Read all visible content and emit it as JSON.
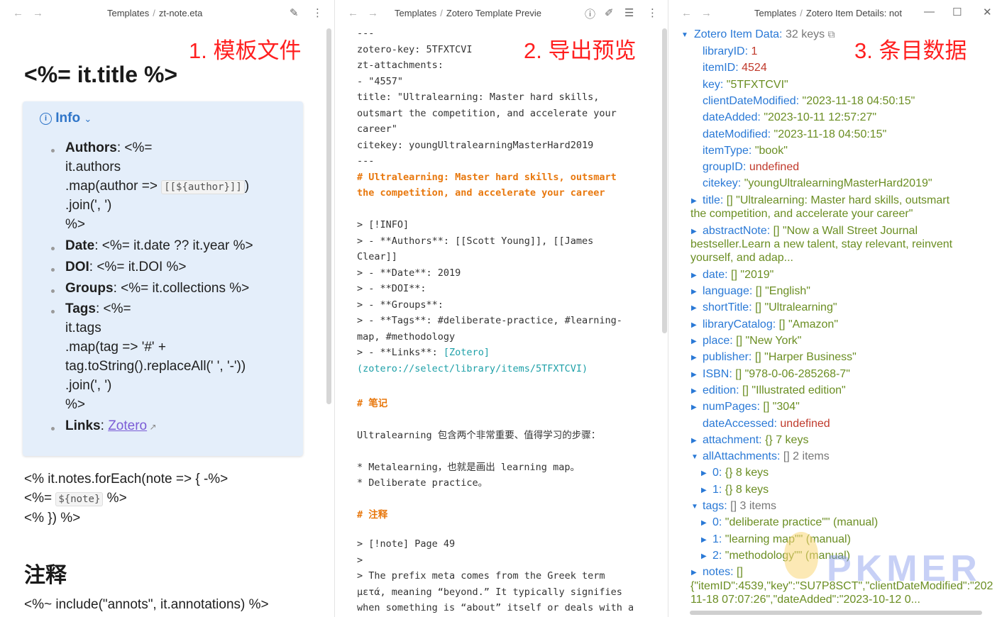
{
  "nav": {
    "back": "←",
    "forward": "→"
  },
  "pane1": {
    "breadcrumb": [
      "Templates",
      "zt-note.eta"
    ],
    "watermark": "1. 模板文件",
    "heading": "<%= it.title %>",
    "callout_title": "Info",
    "callout_lines": [
      {
        "label": "Authors",
        "text": ": <%="
      },
      {
        "text": "it.authors"
      },
      {
        "text": ".map(author =>",
        "code": "[[${author}]]",
        "tail": ")"
      },
      {
        "text": ".join(', ')"
      },
      {
        "text": "%>"
      },
      {
        "label": "Date",
        "text": ": <%= it.date ?? it.year %>"
      },
      {
        "label": "DOI",
        "text": ": <%= it.DOI %>"
      },
      {
        "label": "Groups",
        "text": ": <%= it.collections %>"
      },
      {
        "label": "Tags",
        "text": ": <%="
      },
      {
        "text": "it.tags"
      },
      {
        "text": ".map(tag => '#' +"
      },
      {
        "text": "tag.toString().replaceAll(' ', '-'))"
      },
      {
        "text": ".join(', ')"
      },
      {
        "text": "%>"
      },
      {
        "label": "Links",
        "text": ": ",
        "link": "Zotero"
      }
    ],
    "body_lines": [
      "<% it.notes.forEach(note => { -%>",
      "<%=",
      "<% }) %>"
    ],
    "body_code": "${note}",
    "body_tail": "%>",
    "h2": "注释",
    "last_line": "<%~ include(\"annots\", it.annotations) %>"
  },
  "pane2": {
    "breadcrumb": [
      "Templates",
      "Zotero Template Previe"
    ],
    "watermark": "2. 导出预览",
    "lines": [
      {
        "t": "---"
      },
      {
        "t": "zotero-key: 5TFXTCVI"
      },
      {
        "t": "zt-attachments:"
      },
      {
        "t": "  - \"4557\""
      },
      {
        "t": "title: \"Ultralearning: Master hard skills,"
      },
      {
        "t": "outsmart the competition, and accelerate your"
      },
      {
        "t": "career\""
      },
      {
        "t": "citekey: youngUltralearningMasterHard2019"
      },
      {
        "t": "---"
      },
      {
        "t": "# Ultralearning: Master hard skills, outsmart",
        "o": true
      },
      {
        "t": "the competition, and accelerate your career",
        "o": true
      },
      {
        "t": ""
      },
      {
        "t": "> [!INFO]"
      },
      {
        "t": "> - **Authors**: [[Scott Young]], [[James"
      },
      {
        "t": "Clear]]"
      },
      {
        "t": "> - **Date**: 2019"
      },
      {
        "t": "> - **DOI**:"
      },
      {
        "t": "> - **Groups**:"
      },
      {
        "t": "> - **Tags**: #deliberate-practice, #learning-"
      },
      {
        "t": "map, #methodology"
      },
      {
        "t": "> - **Links**: ",
        "teal": "[Zotero]"
      },
      {
        "t": "",
        "teal": "(zotero://select/library/items/5TFXTCVI)"
      },
      {
        "t": ""
      },
      {
        "t": "# 笔记",
        "o": true
      },
      {
        "t": ""
      },
      {
        "t": "Ultralearning 包含两个非常重要、值得学习的步骤："
      },
      {
        "t": ""
      },
      {
        "t": "*   Metalearning，也就是画出 learning map。"
      },
      {
        "t": "*   Deliberate practice。"
      },
      {
        "t": ""
      },
      {
        "t": "# 注释",
        "o": true
      },
      {
        "t": ""
      },
      {
        "t": "> [!note] Page 49"
      },
      {
        "t": ">"
      },
      {
        "t": "> The prefix meta comes from the Greek term"
      },
      {
        "t": "μετά, meaning “beyond.” It typically signifies"
      },
      {
        "t": "when something is “about” itself or deals with a"
      }
    ]
  },
  "pane3": {
    "breadcrumb": [
      "Templates",
      "Zotero Item Details: not"
    ],
    "watermark": "3. 条目数据",
    "root": {
      "key": "Zotero Item Data:",
      "val": "32 keys"
    },
    "rows": [
      {
        "k": "libraryID:",
        "v": "1",
        "t": "n"
      },
      {
        "k": "itemID:",
        "v": "4524",
        "t": "n"
      },
      {
        "k": "key:",
        "v": "\"5TFXTCVI\"",
        "t": "s"
      },
      {
        "k": "clientDateModified:",
        "v": "\"2023-11-18 04:50:15\"",
        "t": "s"
      },
      {
        "k": "dateAdded:",
        "v": "\"2023-10-11 12:57:27\"",
        "t": "s"
      },
      {
        "k": "dateModified:",
        "v": "\"2023-11-18 04:50:15\"",
        "t": "s"
      },
      {
        "k": "itemType:",
        "v": "\"book\"",
        "t": "s"
      },
      {
        "k": "groupID:",
        "v": "undefined",
        "t": "n"
      },
      {
        "k": "citekey:",
        "v": "\"youngUltralearningMasterHard2019\"",
        "t": "s"
      },
      {
        "k": "title:",
        "v": "[]  \"Ultralearning: Master hard skills, outsmart",
        "t": "s",
        "tri": true,
        "wrap": "the competition, and accelerate your career\""
      },
      {
        "k": "abstractNote:",
        "v": "[]  \"Now a Wall Street Journal",
        "t": "s",
        "tri": true,
        "wrap": "bestseller.Learn a new talent, stay relevant, reinvent",
        "wrap2": "yourself, and adap..."
      },
      {
        "k": "date:",
        "v": "[]  \"2019\"",
        "t": "s",
        "tri": true
      },
      {
        "k": "language:",
        "v": "[]  \"English\"",
        "t": "s",
        "tri": true
      },
      {
        "k": "shortTitle:",
        "v": "[]  \"Ultralearning\"",
        "t": "s",
        "tri": true
      },
      {
        "k": "libraryCatalog:",
        "v": "[]  \"Amazon\"",
        "t": "s",
        "tri": true
      },
      {
        "k": "place:",
        "v": "[]  \"New York\"",
        "t": "s",
        "tri": true
      },
      {
        "k": "publisher:",
        "v": "[]  \"Harper Business\"",
        "t": "s",
        "tri": true
      },
      {
        "k": "ISBN:",
        "v": "[]  \"978-0-06-285268-7\"",
        "t": "s",
        "tri": true
      },
      {
        "k": "edition:",
        "v": "[]  \"Illustrated edition\"",
        "t": "s",
        "tri": true
      },
      {
        "k": "numPages:",
        "v": "[]  \"304\"",
        "t": "s",
        "tri": true
      },
      {
        "k": "dateAccessed:",
        "v": "undefined",
        "t": "n"
      },
      {
        "k": "attachment:",
        "v": "{}  7 keys",
        "t": "s",
        "tri": true
      },
      {
        "k": "allAttachments:",
        "v": "[]  2 items",
        "t": "g",
        "tri": true,
        "open": true
      },
      {
        "k": "0:",
        "v": "{}  8 keys",
        "t": "s",
        "tri": true,
        "lvl": 2
      },
      {
        "k": "1:",
        "v": "{}  8 keys",
        "t": "s",
        "tri": true,
        "lvl": 2
      },
      {
        "k": "tags:",
        "v": "[]  3 items",
        "t": "g",
        "tri": true,
        "open": true
      },
      {
        "k": "0:",
        "v": "\"deliberate practice\"\" (manual)",
        "t": "s",
        "tri": true,
        "lvl": 2
      },
      {
        "k": "1:",
        "v": "\"learning map\"\" (manual)",
        "t": "s",
        "tri": true,
        "lvl": 2
      },
      {
        "k": "2:",
        "v": "\"methodology\"\" (manual)",
        "t": "s",
        "tri": true,
        "lvl": 2
      },
      {
        "k": "notes:",
        "v": "[]",
        "t": "s",
        "tri": true,
        "wrap": "{\"itemID\":4539,\"key\":\"SU7P8SCT\",\"clientDateModified\":\"202",
        "wrap2": "11-18 07:07:26\",\"dateAdded\":\"2023-10-12 0..."
      }
    ],
    "brand": "PKMER"
  }
}
